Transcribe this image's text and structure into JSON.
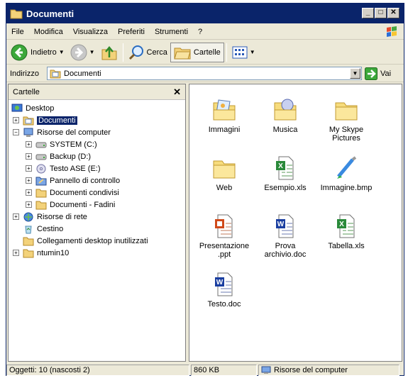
{
  "window": {
    "title": "Documenti"
  },
  "titlebar": {
    "minimize_icon": "minimize-icon",
    "maximize_icon": "maximize-icon",
    "close_icon": "close-icon"
  },
  "menu": [
    "File",
    "Modifica",
    "Visualizza",
    "Preferiti",
    "Strumenti",
    "?"
  ],
  "toolbar": {
    "back_label": "Indietro",
    "search_label": "Cerca",
    "folders_label": "Cartelle"
  },
  "address": {
    "label": "Indirizzo",
    "value": "Documenti",
    "go_label": "Vai"
  },
  "folders_pane": {
    "title": "Cartelle",
    "tree": [
      {
        "label": "Desktop",
        "level": 0,
        "expander": "",
        "icon": "desktop"
      },
      {
        "label": "Documenti",
        "level": 1,
        "expander": "+",
        "icon": "mydocs",
        "selected": true
      },
      {
        "label": "Risorse del computer",
        "level": 1,
        "expander": "−",
        "icon": "computer"
      },
      {
        "label": "SYSTEM (C:)",
        "level": 2,
        "expander": "+",
        "icon": "drive"
      },
      {
        "label": "Backup (D:)",
        "level": 2,
        "expander": "+",
        "icon": "drive"
      },
      {
        "label": "Testo ASE (E:)",
        "level": 2,
        "expander": "+",
        "icon": "cd"
      },
      {
        "label": "Pannello di controllo",
        "level": 2,
        "expander": "+",
        "icon": "control"
      },
      {
        "label": "Documenti condivisi",
        "level": 2,
        "expander": "+",
        "icon": "folder"
      },
      {
        "label": "Documenti - Fadini",
        "level": 2,
        "expander": "+",
        "icon": "folder"
      },
      {
        "label": "Risorse di rete",
        "level": 1,
        "expander": "+",
        "icon": "network"
      },
      {
        "label": "Cestino",
        "level": 1,
        "expander": "",
        "icon": "recycle"
      },
      {
        "label": "Collegamenti desktop inutilizzati",
        "level": 1,
        "expander": "",
        "icon": "folder"
      },
      {
        "label": "ntumin10",
        "level": 1,
        "expander": "+",
        "icon": "folder"
      }
    ]
  },
  "files": [
    {
      "name": "Immagini",
      "icon": "folder-pictures"
    },
    {
      "name": "Musica",
      "icon": "folder-music"
    },
    {
      "name": "My Skype Pictures",
      "icon": "folder"
    },
    {
      "name": "Web",
      "icon": "folder"
    },
    {
      "name": "Esempio.xls",
      "icon": "excel"
    },
    {
      "name": "Immagine.bmp",
      "icon": "paint"
    },
    {
      "name": "Presentazione .ppt",
      "icon": "powerpoint"
    },
    {
      "name": "Prova archivio.doc",
      "icon": "word"
    },
    {
      "name": "Tabella.xls",
      "icon": "excel"
    },
    {
      "name": "Testo.doc",
      "icon": "word"
    }
  ],
  "status": {
    "objects": "Oggetti: 10 (nascosti 2)",
    "size": "860 KB",
    "location": "Risorse del computer"
  }
}
